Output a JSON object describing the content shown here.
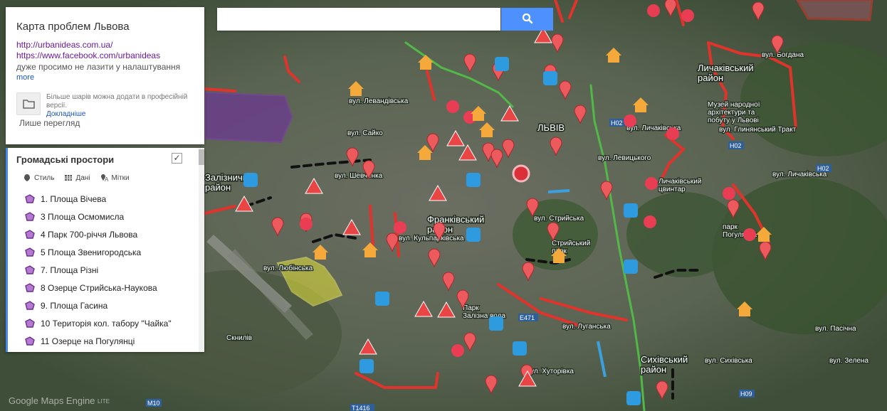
{
  "search": {
    "placeholder": ""
  },
  "info": {
    "title": "Карта проблем Львова",
    "link_1": "http://urbanideas.com.ua/",
    "link_2": "https://www.facebook.com/urbanideas",
    "description": "дуже просимо не лазити у налаштування",
    "more": "more",
    "pro_text": "Більше шарів можна додати в професійній версії.",
    "pro_link": "Докладніше",
    "view_only": "Лише перегляд"
  },
  "layer": {
    "title": "Громадські простори",
    "checked": "✓",
    "tools": {
      "style": "Стиль",
      "data": "Дані",
      "labels": "Мітки"
    },
    "items": [
      "1. Площа Вічева",
      "3 Площа Осмомисла",
      "4 Парк 700-річчя Львова",
      "5 Площа Звенигородська",
      "7. Площа Різні",
      "8 Озерце Стрийська-Наукова",
      "9. Площа Гасина",
      "10 Територія кол. табору \"Чайка\"",
      "11 Озерце на Погулянці"
    ]
  },
  "map_labels": {
    "lychakiv": "Личаківський\nрайон",
    "zaliznychnyi": "Залізничн\nрайон",
    "frankivskyi": "Франківський\nрайон",
    "sykhivskyi": "Сихівський\nрайон",
    "lviv": "ЛЬВІВ",
    "museum": "Музей народної\nархітектури та\nпобуту у Львові",
    "cemetery": "Личаківський\nцвинтар",
    "park_pohulianka": "парк\nПогулянка",
    "stryiskyi_park": "Стрийський\nпарк",
    "park_zalizni_vody": "Парк\nЗалізна вода",
    "skniliv": "Скнилів",
    "vul_levandivska": "вул. Левандівська",
    "vul_lychakivska": "вул. Личаківська",
    "vul_lychakivska_2": "вул. Личаківська",
    "vul_lytsytskoho": "вул. Левицького",
    "vul_hlynianskyi": "вул. Глинянський Тракт",
    "vul_luhanska": "вул. Луганська",
    "vul_khutorivka": "вул. Хуторівка",
    "vul_stryiska": "вул. Стрийська",
    "vul_kulparkivska": "вул. Кульпарківська",
    "vul_liubinska": "вул. Любінська",
    "vul_sykhivska": "вул. Сихівська",
    "vul_zelena": "вул. Зелена",
    "vul_pasichna": "вул. Пасічна",
    "vul_boh": "вул. Богдана",
    "vul_shevchenka": "вул. Шевченка",
    "vul_saiko": "вул. Сайко",
    "road_h02a": "H02",
    "road_h02b": "H02",
    "road_h02c": "H02",
    "road_h09": "H09",
    "road_e471": "E471",
    "road_m10": "M10",
    "road_t1416": "T1416"
  },
  "logo": {
    "text": "Google Maps Engine",
    "lite": "LITE"
  },
  "colors": {
    "accent": "#4285f4",
    "marker_red": "#e8474b",
    "polygon_purple": "#7b3fa0",
    "path_red": "#e0332c",
    "path_green": "#4caf50",
    "panel_bg": "#ffffff"
  }
}
